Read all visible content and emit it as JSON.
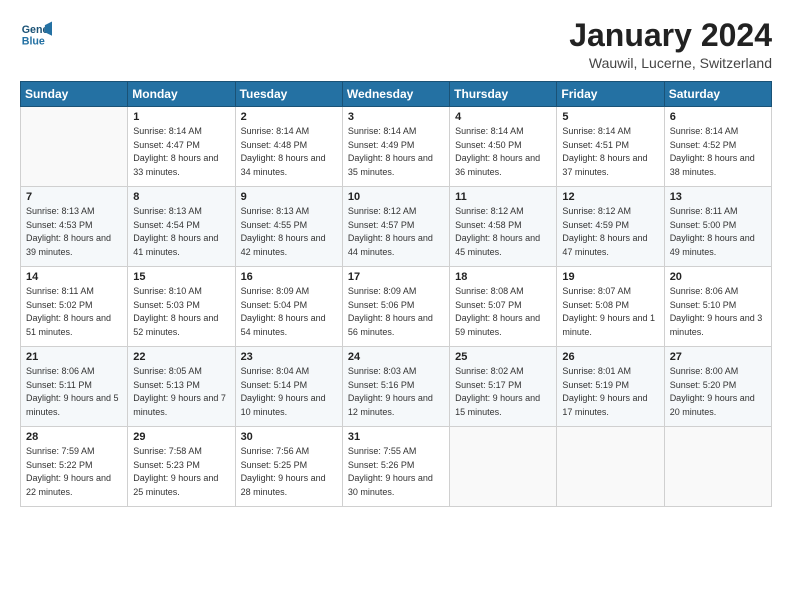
{
  "app": {
    "logo_line1": "General",
    "logo_line2": "Blue"
  },
  "header": {
    "month": "January 2024",
    "location": "Wauwil, Lucerne, Switzerland"
  },
  "weekdays": [
    "Sunday",
    "Monday",
    "Tuesday",
    "Wednesday",
    "Thursday",
    "Friday",
    "Saturday"
  ],
  "weeks": [
    [
      {
        "day": "",
        "sunrise": "",
        "sunset": "",
        "daylight": ""
      },
      {
        "day": "1",
        "sunrise": "Sunrise: 8:14 AM",
        "sunset": "Sunset: 4:47 PM",
        "daylight": "Daylight: 8 hours and 33 minutes."
      },
      {
        "day": "2",
        "sunrise": "Sunrise: 8:14 AM",
        "sunset": "Sunset: 4:48 PM",
        "daylight": "Daylight: 8 hours and 34 minutes."
      },
      {
        "day": "3",
        "sunrise": "Sunrise: 8:14 AM",
        "sunset": "Sunset: 4:49 PM",
        "daylight": "Daylight: 8 hours and 35 minutes."
      },
      {
        "day": "4",
        "sunrise": "Sunrise: 8:14 AM",
        "sunset": "Sunset: 4:50 PM",
        "daylight": "Daylight: 8 hours and 36 minutes."
      },
      {
        "day": "5",
        "sunrise": "Sunrise: 8:14 AM",
        "sunset": "Sunset: 4:51 PM",
        "daylight": "Daylight: 8 hours and 37 minutes."
      },
      {
        "day": "6",
        "sunrise": "Sunrise: 8:14 AM",
        "sunset": "Sunset: 4:52 PM",
        "daylight": "Daylight: 8 hours and 38 minutes."
      }
    ],
    [
      {
        "day": "7",
        "sunrise": "Sunrise: 8:13 AM",
        "sunset": "Sunset: 4:53 PM",
        "daylight": "Daylight: 8 hours and 39 minutes."
      },
      {
        "day": "8",
        "sunrise": "Sunrise: 8:13 AM",
        "sunset": "Sunset: 4:54 PM",
        "daylight": "Daylight: 8 hours and 41 minutes."
      },
      {
        "day": "9",
        "sunrise": "Sunrise: 8:13 AM",
        "sunset": "Sunset: 4:55 PM",
        "daylight": "Daylight: 8 hours and 42 minutes."
      },
      {
        "day": "10",
        "sunrise": "Sunrise: 8:12 AM",
        "sunset": "Sunset: 4:57 PM",
        "daylight": "Daylight: 8 hours and 44 minutes."
      },
      {
        "day": "11",
        "sunrise": "Sunrise: 8:12 AM",
        "sunset": "Sunset: 4:58 PM",
        "daylight": "Daylight: 8 hours and 45 minutes."
      },
      {
        "day": "12",
        "sunrise": "Sunrise: 8:12 AM",
        "sunset": "Sunset: 4:59 PM",
        "daylight": "Daylight: 8 hours and 47 minutes."
      },
      {
        "day": "13",
        "sunrise": "Sunrise: 8:11 AM",
        "sunset": "Sunset: 5:00 PM",
        "daylight": "Daylight: 8 hours and 49 minutes."
      }
    ],
    [
      {
        "day": "14",
        "sunrise": "Sunrise: 8:11 AM",
        "sunset": "Sunset: 5:02 PM",
        "daylight": "Daylight: 8 hours and 51 minutes."
      },
      {
        "day": "15",
        "sunrise": "Sunrise: 8:10 AM",
        "sunset": "Sunset: 5:03 PM",
        "daylight": "Daylight: 8 hours and 52 minutes."
      },
      {
        "day": "16",
        "sunrise": "Sunrise: 8:09 AM",
        "sunset": "Sunset: 5:04 PM",
        "daylight": "Daylight: 8 hours and 54 minutes."
      },
      {
        "day": "17",
        "sunrise": "Sunrise: 8:09 AM",
        "sunset": "Sunset: 5:06 PM",
        "daylight": "Daylight: 8 hours and 56 minutes."
      },
      {
        "day": "18",
        "sunrise": "Sunrise: 8:08 AM",
        "sunset": "Sunset: 5:07 PM",
        "daylight": "Daylight: 8 hours and 59 minutes."
      },
      {
        "day": "19",
        "sunrise": "Sunrise: 8:07 AM",
        "sunset": "Sunset: 5:08 PM",
        "daylight": "Daylight: 9 hours and 1 minute."
      },
      {
        "day": "20",
        "sunrise": "Sunrise: 8:06 AM",
        "sunset": "Sunset: 5:10 PM",
        "daylight": "Daylight: 9 hours and 3 minutes."
      }
    ],
    [
      {
        "day": "21",
        "sunrise": "Sunrise: 8:06 AM",
        "sunset": "Sunset: 5:11 PM",
        "daylight": "Daylight: 9 hours and 5 minutes."
      },
      {
        "day": "22",
        "sunrise": "Sunrise: 8:05 AM",
        "sunset": "Sunset: 5:13 PM",
        "daylight": "Daylight: 9 hours and 7 minutes."
      },
      {
        "day": "23",
        "sunrise": "Sunrise: 8:04 AM",
        "sunset": "Sunset: 5:14 PM",
        "daylight": "Daylight: 9 hours and 10 minutes."
      },
      {
        "day": "24",
        "sunrise": "Sunrise: 8:03 AM",
        "sunset": "Sunset: 5:16 PM",
        "daylight": "Daylight: 9 hours and 12 minutes."
      },
      {
        "day": "25",
        "sunrise": "Sunrise: 8:02 AM",
        "sunset": "Sunset: 5:17 PM",
        "daylight": "Daylight: 9 hours and 15 minutes."
      },
      {
        "day": "26",
        "sunrise": "Sunrise: 8:01 AM",
        "sunset": "Sunset: 5:19 PM",
        "daylight": "Daylight: 9 hours and 17 minutes."
      },
      {
        "day": "27",
        "sunrise": "Sunrise: 8:00 AM",
        "sunset": "Sunset: 5:20 PM",
        "daylight": "Daylight: 9 hours and 20 minutes."
      }
    ],
    [
      {
        "day": "28",
        "sunrise": "Sunrise: 7:59 AM",
        "sunset": "Sunset: 5:22 PM",
        "daylight": "Daylight: 9 hours and 22 minutes."
      },
      {
        "day": "29",
        "sunrise": "Sunrise: 7:58 AM",
        "sunset": "Sunset: 5:23 PM",
        "daylight": "Daylight: 9 hours and 25 minutes."
      },
      {
        "day": "30",
        "sunrise": "Sunrise: 7:56 AM",
        "sunset": "Sunset: 5:25 PM",
        "daylight": "Daylight: 9 hours and 28 minutes."
      },
      {
        "day": "31",
        "sunrise": "Sunrise: 7:55 AM",
        "sunset": "Sunset: 5:26 PM",
        "daylight": "Daylight: 9 hours and 30 minutes."
      },
      {
        "day": "",
        "sunrise": "",
        "sunset": "",
        "daylight": ""
      },
      {
        "day": "",
        "sunrise": "",
        "sunset": "",
        "daylight": ""
      },
      {
        "day": "",
        "sunrise": "",
        "sunset": "",
        "daylight": ""
      }
    ]
  ]
}
